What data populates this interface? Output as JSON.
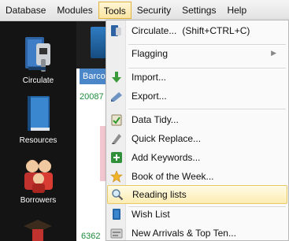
{
  "menubar": {
    "items": [
      "Database",
      "Modules",
      "Tools",
      "Security",
      "Settings",
      "Help"
    ]
  },
  "sidebar": {
    "items": [
      {
        "label": "Circulate",
        "icon": "circulate-scanner-icon"
      },
      {
        "label": "Resources",
        "icon": "book-icon"
      },
      {
        "label": "Borrowers",
        "icon": "people-icon"
      }
    ]
  },
  "content": {
    "header_text": "Barco",
    "cell_top": "20087",
    "cell_bottom": "6362"
  },
  "tools_menu": {
    "items": [
      {
        "label": "Circulate...",
        "shortcut": "(Shift+CTRL+C)",
        "icon": "circulate-icon"
      },
      {
        "label": "Flagging",
        "icon": "none",
        "submenu": true
      },
      {
        "label": "Import...",
        "icon": "import-arrow-icon"
      },
      {
        "label": "Export...",
        "icon": "export-icon"
      },
      {
        "label": "Data Tidy...",
        "icon": "data-tidy-icon"
      },
      {
        "label": "Quick Replace...",
        "icon": "quick-replace-icon"
      },
      {
        "label": "Add Keywords...",
        "icon": "add-keywords-icon"
      },
      {
        "label": "Book of the Week...",
        "icon": "star-icon"
      },
      {
        "label": "Reading lists",
        "icon": "magnifier-icon",
        "highlighted": true
      },
      {
        "label": "Wish List",
        "icon": "wish-list-icon"
      },
      {
        "label": "New Arrivals & Top Ten...",
        "icon": "new-arrivals-icon"
      }
    ]
  },
  "colors": {
    "menu_highlight": "#fcecb2",
    "sidebar_bg": "#141414",
    "accent_blue": "#4b86c8"
  }
}
